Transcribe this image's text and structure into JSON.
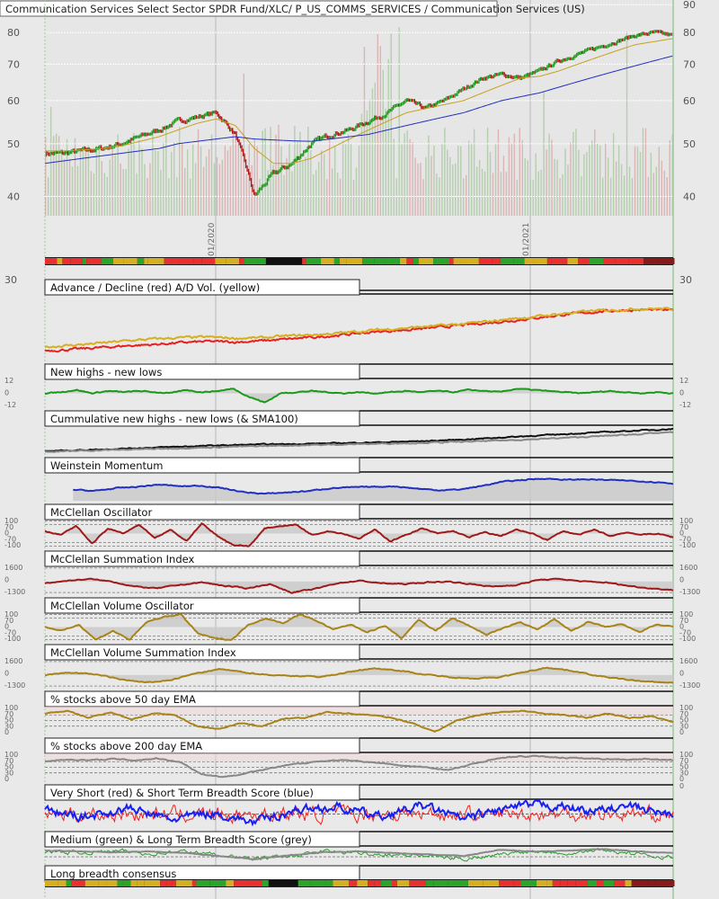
{
  "chart_data": {
    "type": "line",
    "title": "Communication Services Select Sector SPDR Fund/XLC/ P_US_COMMS_SERVICES / Communication Services (US)",
    "x_labels": [
      "01/2020",
      "01/2021"
    ],
    "price_panel": {
      "scale": "log",
      "ylim": [
        38,
        92
      ],
      "yticks": [
        40,
        50,
        60,
        70,
        80,
        90
      ],
      "series": [
        {
          "name": "Price",
          "type": "candles",
          "colors": {
            "up": "#1a9a1a",
            "down": "#b01515"
          },
          "values": [
            48,
            48,
            48.5,
            49,
            50,
            51.5,
            53,
            55,
            56,
            57,
            52,
            40,
            44,
            46,
            50,
            52,
            53,
            55,
            57,
            60,
            58,
            60,
            63,
            66,
            67,
            66,
            68,
            71,
            73,
            75,
            77,
            79,
            80,
            79
          ]
        },
        {
          "name": "SMA 50",
          "color": "#c8a020",
          "values": [
            48.5,
            48.5,
            48.7,
            49,
            49.5,
            50.5,
            51.5,
            53,
            54.5,
            55.5,
            54,
            49,
            46,
            46,
            47,
            49,
            51,
            53,
            55,
            57,
            58,
            59,
            60,
            62,
            64,
            66,
            66.5,
            68,
            70,
            72,
            74,
            76,
            77,
            78
          ]
        },
        {
          "name": "SMA 200",
          "color": "#2030c0",
          "values": [
            46,
            46.5,
            47,
            47.5,
            48,
            48.5,
            49,
            50,
            50.5,
            51,
            51.5,
            51,
            50.8,
            50.6,
            50.5,
            51,
            51.5,
            52,
            53,
            54,
            55,
            56,
            57,
            58.5,
            60,
            61,
            62,
            63.5,
            65,
            66.5,
            68,
            69.5,
            71,
            72.5
          ]
        },
        {
          "name": "Volume",
          "type": "bars",
          "colors": {
            "up": "#a8c8a0",
            "down": "#d8a8a8"
          }
        }
      ]
    },
    "breadth_band": {
      "name": "short breadth consensus",
      "colors": [
        "#2aa52a",
        "#d4b020",
        "#e83030",
        "#111111",
        "#8a1a1a"
      ]
    },
    "panels": [
      {
        "title": "Advance / Decline (red) A/D Vol. (yellow)",
        "ticks_left": [
          "30"
        ],
        "ticks_right": [
          "30"
        ],
        "ylim": [
          0,
          10
        ],
        "fill": false,
        "series": [
          {
            "name": "A/D",
            "color": "#e82020",
            "values": [
              1,
              1.2,
              1.5,
              1.8,
              2,
              2.3,
              2.5,
              2.4,
              2.6,
              2.9,
              3.2,
              3.6,
              4,
              4.3,
              4.6,
              5,
              5.4,
              5.8,
              6.3,
              6.8,
              7.2,
              7.5,
              7.6,
              7.5
            ]
          },
          {
            "name": "A/D Vol",
            "color": "#d4b020",
            "values": [
              1.6,
              1.9,
              2.2,
              2.6,
              2.9,
              3.1,
              3.2,
              3,
              3.1,
              3.4,
              3.6,
              3.9,
              4.3,
              4.6,
              4.9,
              5.2,
              5.6,
              6.1,
              6.5,
              7,
              7.4,
              7.6,
              7.8,
              7.7
            ]
          }
        ]
      },
      {
        "title": "New highs - new lows",
        "ticks_left": [
          "12",
          "0",
          "-12"
        ],
        "ticks_right": [
          "12",
          "0",
          "-12"
        ],
        "ylim": [
          -12,
          12
        ],
        "fill": true,
        "zero": 0,
        "series": [
          {
            "name": "NH-NL",
            "color": "#1a9a1a",
            "values": [
              0,
              1,
              3,
              0,
              2,
              1,
              2,
              1,
              0,
              3,
              1,
              2,
              4,
              -3,
              -8,
              0,
              1,
              2,
              1,
              0,
              1,
              0,
              1,
              2,
              1,
              2,
              1,
              3,
              2,
              1,
              4,
              3,
              2,
              1,
              0,
              1,
              2,
              1,
              0,
              1,
              0
            ]
          }
        ]
      },
      {
        "title": "Cummulative new highs - new lows (& SMA100)",
        "ticks_left": [],
        "ticks_right": [],
        "ylim": [
          0,
          10
        ],
        "fill": false,
        "series": [
          {
            "name": "Cumulative",
            "color": "#111111",
            "values": [
              1,
              1.5,
              2,
              2.5,
              3,
              3.4,
              3.6,
              3.9,
              4.2,
              4.6,
              5.2,
              6,
              6.8,
              7.6,
              8.3,
              9
            ]
          },
          {
            "name": "SMA100",
            "color": "#888888",
            "values": [
              0.8,
              1.2,
              1.6,
              2,
              2.4,
              2.8,
              3.1,
              3.4,
              3.7,
              4,
              4.4,
              4.9,
              5.5,
              6.2,
              7,
              7.8
            ]
          }
        ]
      },
      {
        "title": "Weinstein Momentum",
        "ticks_left": [],
        "ticks_right": [],
        "ylim": [
          0,
          10
        ],
        "fill": true,
        "zero": 0,
        "start_fraction": 0.045,
        "series": [
          {
            "name": "Momentum",
            "color": "#2030c0",
            "values": [
              4,
              3.5,
              4.5,
              5,
              5.8,
              5.2,
              5.4,
              4.5,
              3,
              2.5,
              3,
              3.5,
              4.5,
              4.8,
              5,
              5.2,
              4.4,
              3.8,
              4,
              5.2,
              6.8,
              7.5,
              8,
              7.5,
              7.7,
              7.4,
              7.2,
              6.8,
              6.2
            ]
          }
        ]
      },
      {
        "title": "McClellan Oscillator",
        "ticks_left": [
          "100",
          "70",
          "0",
          "-70",
          "-100"
        ],
        "ticks_right": [
          "100",
          "70",
          "0",
          "-70",
          "-100"
        ],
        "ylim": [
          -110,
          110
        ],
        "fill": true,
        "zero": 0,
        "guides": [
          100,
          70,
          -70,
          -100
        ],
        "series": [
          {
            "name": "Oscillator",
            "color": "#a01818",
            "values": [
              20,
              -10,
              60,
              -80,
              40,
              0,
              70,
              -40,
              30,
              -60,
              80,
              -20,
              -90,
              -100,
              40,
              60,
              70,
              -10,
              20,
              0,
              -40,
              30,
              -60,
              -10,
              40,
              0,
              20,
              -30,
              10,
              -20,
              30,
              0,
              -50,
              20,
              -10,
              30,
              -20,
              10,
              -10,
              0,
              -30
            ]
          }
        ]
      },
      {
        "title": "McClellan Summation Index",
        "ticks_left": [
          "1600",
          "0",
          "-1300"
        ],
        "ticks_right": [
          "1600",
          "0",
          "-1300"
        ],
        "ylim": [
          -1500,
          1800
        ],
        "fill": true,
        "zero": 0,
        "guides": [
          1600,
          -1300
        ],
        "series": [
          {
            "name": "Summation",
            "color": "#a01818",
            "values": [
              -200,
              100,
              300,
              0,
              -600,
              -800,
              -400,
              -100,
              -500,
              -800,
              -300,
              -1300,
              -900,
              -200,
              100,
              -200,
              -300,
              -100,
              0,
              -300,
              -600,
              -400,
              200,
              300,
              0,
              -100,
              -500,
              -800,
              -1000
            ]
          }
        ]
      },
      {
        "title": "McClellan Volume Oscillator",
        "ticks_left": [
          "100",
          "70",
          "0",
          "-70",
          "-100"
        ],
        "ticks_right": [
          "100",
          "70",
          "0",
          "-70",
          "-100"
        ],
        "ylim": [
          -110,
          110
        ],
        "fill": true,
        "zero": 0,
        "guides": [
          100,
          70,
          -70,
          -100
        ],
        "series": [
          {
            "name": "Vol Oscillator",
            "color": "#a88418",
            "values": [
              0,
              -30,
              20,
              -100,
              -30,
              -100,
              40,
              80,
              100,
              -50,
              -90,
              -100,
              20,
              70,
              30,
              100,
              50,
              -20,
              20,
              -40,
              10,
              -90,
              60,
              -30,
              70,
              10,
              -60,
              -10,
              40,
              -20,
              60,
              -30,
              40,
              0,
              20,
              -40,
              20,
              0
            ]
          }
        ]
      },
      {
        "title": "McClellan Volume Summation Index",
        "ticks_left": [
          "1600",
          "0",
          "-1300"
        ],
        "ticks_right": [
          "1600",
          "0",
          "-1300"
        ],
        "ylim": [
          -1500,
          1800
        ],
        "fill": true,
        "zero": 0,
        "guides": [
          1600,
          -1300
        ],
        "series": [
          {
            "name": "Vol Summation",
            "color": "#a88418",
            "values": [
              0,
              300,
              100,
              -500,
              -900,
              -600,
              200,
              700,
              300,
              0,
              -100,
              -200,
              300,
              800,
              600,
              100,
              -200,
              -400,
              -300,
              300,
              900,
              500,
              -100,
              -500,
              -800,
              -900
            ]
          }
        ]
      },
      {
        "title": "% stocks above 50 day EMA",
        "ticks_left": [
          "100",
          "70",
          "50",
          "30",
          "0"
        ],
        "ticks_right": [
          "100",
          "70",
          "50",
          "30",
          "0"
        ],
        "ylim": [
          0,
          100
        ],
        "fill": false,
        "guides": [
          70,
          50,
          30
        ],
        "highlight": 70,
        "series": [
          {
            "name": "% > 50 EMA",
            "color": "#a88418",
            "values": [
              75,
              85,
              60,
              80,
              55,
              75,
              70,
              30,
              20,
              40,
              30,
              55,
              60,
              80,
              75,
              70,
              60,
              40,
              10,
              50,
              70,
              80,
              85,
              75,
              70,
              60,
              75,
              60,
              65,
              45
            ]
          }
        ]
      },
      {
        "title": "% stocks above 200 day EMA",
        "ticks_left": [
          "100",
          "70",
          "50",
          "30",
          "0"
        ],
        "ticks_right": [
          "100",
          "70",
          "50",
          "30",
          "0"
        ],
        "ylim": [
          0,
          100
        ],
        "fill": false,
        "guides": [
          70,
          50,
          30
        ],
        "highlight": 70,
        "series": [
          {
            "name": "% > 200 EMA",
            "color": "#888888",
            "values": [
              72,
              78,
              75,
              80,
              75,
              82,
              70,
              25,
              15,
              30,
              45,
              60,
              70,
              75,
              72,
              65,
              55,
              50,
              40,
              60,
              80,
              88,
              90,
              85,
              82,
              80,
              78,
              80,
              75
            ]
          }
        ]
      },
      {
        "title": "Very Short (red) & Short Term Breadth Score (blue)",
        "ticks_left": [],
        "ticks_right": [
          "0"
        ],
        "ylim": [
          0,
          100
        ],
        "fill": false,
        "guides": [
          50
        ],
        "guide_color": "#2030f0",
        "series": [
          {
            "name": "Very Short",
            "color": "#f02020",
            "noise": 40,
            "values": [
              50,
              50,
              50,
              50,
              50,
              50,
              50,
              50,
              50,
              50,
              50,
              50,
              50,
              50,
              50,
              50
            ]
          },
          {
            "name": "Short",
            "color": "#1a20f0",
            "noise": 25,
            "values": [
              60,
              40,
              70,
              30,
              55,
              20,
              65,
              75,
              40,
              80,
              30,
              70,
              85,
              60,
              75,
              45
            ]
          }
        ]
      },
      {
        "title": "Medium (green) & Long Term Breadth Score (grey)",
        "ticks_left": [],
        "ticks_right": [],
        "ylim": [
          0,
          100
        ],
        "fill": false,
        "guides": [
          35
        ],
        "series": [
          {
            "name": "Medium",
            "color": "#2a9a2a",
            "noise": 20,
            "values": [
              70,
              60,
              75,
              55,
              70,
              50,
              20,
              40,
              70,
              60,
              50,
              40,
              20,
              50,
              75,
              60,
              80,
              50,
              30
            ]
          },
          {
            "name": "Long",
            "color": "#888888",
            "values": [
              75,
              70,
              65,
              70,
              60,
              40,
              20,
              45,
              65,
              70,
              60,
              50,
              40,
              80,
              70,
              75,
              85,
              70,
              60
            ]
          }
        ]
      },
      {
        "title": "Long breadth consensus",
        "ticks_left": [],
        "ticks_right": [],
        "band": true,
        "series": []
      }
    ]
  }
}
